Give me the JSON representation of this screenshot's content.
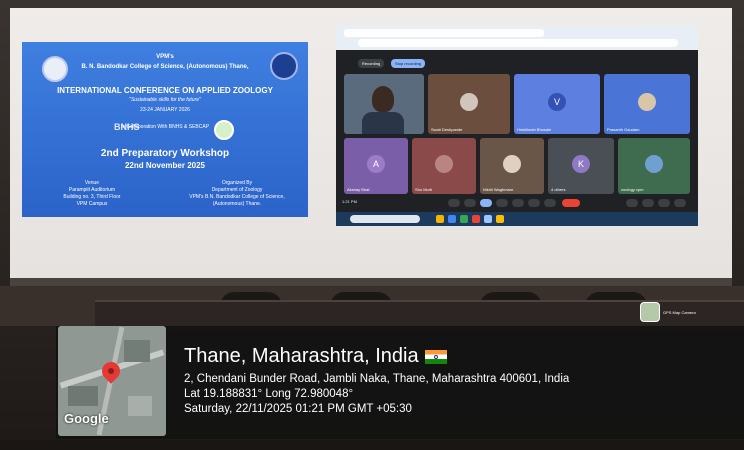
{
  "slide": {
    "line1": "VPM's",
    "line2": "B. N. Bandodkar College of Science, (Autonomous) Thane,",
    "conference_title": "INTERNATIONAL CONFERENCE ON APPLIED ZOOLOGY",
    "tagline": "\"Sustainable skills for the future\"",
    "dates": "23-24 JANUARY 2026",
    "collaboration": "In Collaboration With BNHS & SEBCAP",
    "bnhs_logo_text": "BNHS",
    "workshop": "2nd Preparatory Workshop",
    "workshop_date": "22nd November 2025",
    "venue_heading": "Venue",
    "venue_lines": [
      "Parampiit Auditorium",
      "Building no. 3, Third Floor",
      "VPM Campus"
    ],
    "organiser_heading": "Organized By",
    "organiser_lines": [
      "Department of Zoology",
      "VPM's B.N. Bandodkar College of Science,",
      "(Autonomous) Thane."
    ]
  },
  "meeting": {
    "recording_label": "Recording",
    "stop_recording_label": "Stop recording",
    "time": "1:21 PM",
    "participants": [
      {
        "name": "",
        "initial": ""
      },
      {
        "name": "Swati Deshpande",
        "initial": ""
      },
      {
        "name": "Hrishikesh Bhosale",
        "initial": "V"
      },
      {
        "name": "Prasanth Gaudam",
        "initial": ""
      },
      {
        "name": "Akshay Bhat",
        "initial": "A"
      },
      {
        "name": "Sho Murti",
        "initial": ""
      },
      {
        "name": "Nikhil Waghmare",
        "initial": ""
      },
      {
        "name": "4 others",
        "initial": "K"
      },
      {
        "name": "zoology vpm",
        "initial": ""
      }
    ]
  },
  "gps": {
    "map_brand": "Google",
    "title": "Thane, Maharashtra, India",
    "address": "2, Chendani Bunder Road, Jambli Naka, Thane, Maharashtra 400601, India",
    "coordinates": "Lat 19.188831° Long 72.980048°",
    "datetime": "Saturday, 22/11/2025 01:21 PM GMT +05:30",
    "app_badge": "GPS Map Camera"
  },
  "colors": {
    "slide_blue": "#3f7fe0",
    "meet_dark": "#202124",
    "map_pin": "#e53935",
    "overlay": "#121212"
  }
}
